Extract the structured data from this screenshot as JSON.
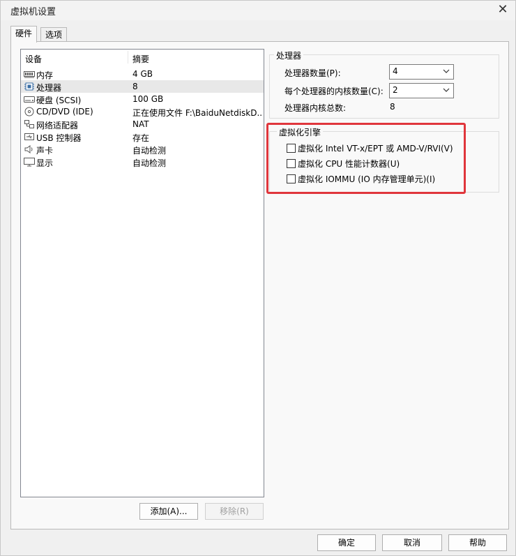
{
  "window": {
    "title": "虚拟机设置",
    "close_glyph": "✕"
  },
  "tabs": [
    {
      "label": "硬件",
      "active": true
    },
    {
      "label": "选项",
      "active": false
    }
  ],
  "device_list": {
    "columns": [
      "设备",
      "摘要"
    ],
    "rows": [
      {
        "icon": "memory-icon",
        "name": "内存",
        "summary": "4 GB"
      },
      {
        "icon": "cpu-icon",
        "name": "处理器",
        "summary": "8",
        "selected": true
      },
      {
        "icon": "harddisk-icon",
        "name": "硬盘 (SCSI)",
        "summary": "100 GB"
      },
      {
        "icon": "cd-dvd-icon",
        "name": "CD/DVD (IDE)",
        "summary": "正在使用文件 F:\\BaiduNetdiskD..."
      },
      {
        "icon": "network-adapter-icon",
        "name": "网络适配器",
        "summary": "NAT"
      },
      {
        "icon": "usb-icon",
        "name": "USB 控制器",
        "summary": "存在"
      },
      {
        "icon": "sound-icon",
        "name": "声卡",
        "summary": "自动检测"
      },
      {
        "icon": "display-icon",
        "name": "显示",
        "summary": "自动检测"
      }
    ]
  },
  "list_buttons": {
    "add": "添加(A)...",
    "remove": "移除(R)"
  },
  "processor": {
    "group_title": "处理器",
    "count_label": "处理器数量(P):",
    "count_value": "4",
    "cores_label": "每个处理器的内核数量(C):",
    "cores_value": "2",
    "total_label": "处理器内核总数:",
    "total_value": "8"
  },
  "virtualization": {
    "group_title": "虚拟化引擎",
    "options": [
      {
        "label": "虚拟化 Intel VT-x/EPT 或 AMD-V/RVI(V)",
        "checked": false
      },
      {
        "label": "虚拟化 CPU 性能计数器(U)",
        "checked": false
      },
      {
        "label": "虚拟化 IOMMU (IO 内存管理单元)(I)",
        "checked": false
      }
    ]
  },
  "footer_buttons": {
    "ok": "确定",
    "cancel": "取消",
    "help": "帮助"
  },
  "colors": {
    "highlight": "#e0363c",
    "selected_row": "#e8e8e8"
  }
}
